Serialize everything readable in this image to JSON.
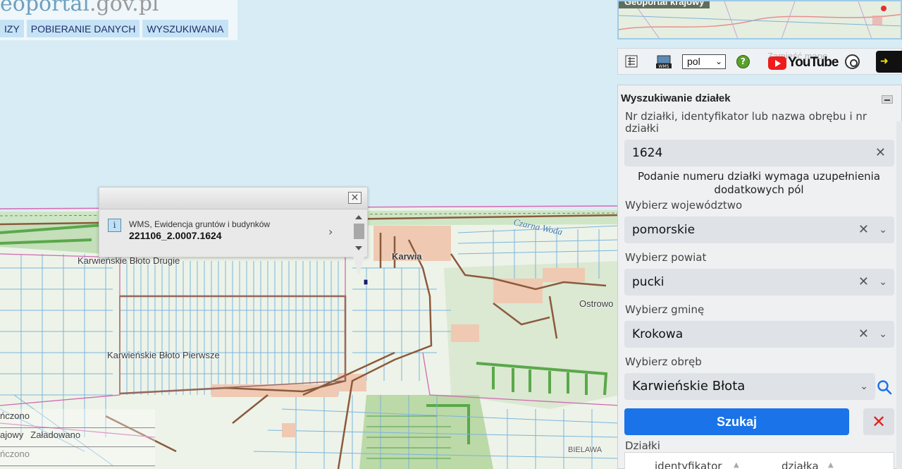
{
  "header": {
    "logo_main": "eoportal",
    "logo_suffix": ".gov.pl",
    "nav": [
      "IZY",
      "POBIERANIE DANYCH",
      "WYSZUKIWANIA"
    ]
  },
  "map": {
    "labels": {
      "karwienskie_bloto_drugie": "Karwieńskie Błoto Drugie",
      "karwienskie_bloto_pierwsze": "Karwieńskie Błoto Pierwsze",
      "karwia": "Karwia",
      "ostrowo": "Ostrowo",
      "czarna_woda": "Czarna Woda",
      "bielawa": "BIELAWA"
    },
    "popup": {
      "source": "WMS, Ewidencja gruntów i budynków",
      "identifier": "221106_2.0007.1624",
      "info_glyph": "i",
      "next_glyph": "›",
      "close_glyph": "×"
    },
    "status": {
      "row1": "ńczono",
      "row2_a": "ajowy",
      "row2_b": "Załadowano",
      "row3": "ńczono"
    }
  },
  "minimap": {
    "title": "Geoportal krajowy"
  },
  "toolbar": {
    "language": "pol",
    "faint_text": "Zamieść mapę",
    "youtube_label": "YouTube",
    "help_glyph": "?",
    "access_glyph": "➜"
  },
  "search_panel": {
    "title": "Wyszukiwanie działek",
    "parcel_label": "Nr działki, identyfikator lub nazwa obrębu i nr działki",
    "parcel_value": "1624",
    "note": "Podanie numeru działki wymaga uzupełnienia dodatkowych pól",
    "voivodeship_label": "Wybierz województwo",
    "voivodeship_value": "pomorskie",
    "county_label": "Wybierz powiat",
    "county_value": "pucki",
    "commune_label": "Wybierz gminę",
    "commune_value": "Krokowa",
    "precinct_label": "Wybierz obręb",
    "precinct_value": "Karwieńskie Błota",
    "search_button": "Szukaj",
    "clear_glyph": "✕",
    "clear_field_glyph": "✕",
    "dropdown_glyph": "⌄",
    "results_label": "Działki",
    "col_identifier": "identyfikator",
    "col_parcel": "działka",
    "sort_glyph": "▲"
  }
}
